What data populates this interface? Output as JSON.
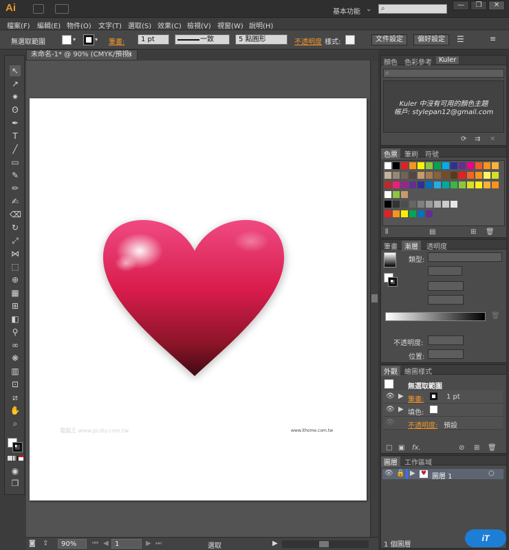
{
  "app": {
    "logo": "Ai",
    "workspace": "基本功能",
    "window_buttons": [
      "—",
      "❐",
      "✕"
    ]
  },
  "menubar": [
    "檔案(F)",
    "編輯(E)",
    "物件(O)",
    "文字(T)",
    "選取(S)",
    "效果(C)",
    "檢視(V)",
    "視窗(W)",
    "說明(H)"
  ],
  "control": {
    "no_selection": "無選取範圍",
    "stroke_label": "筆畫:",
    "stroke_value": "1 pt",
    "line_style": "一致",
    "brush": "5 點圓形",
    "opacity_label": "不透明度",
    "style_label": "樣式:",
    "doc_setup": "文件設定",
    "prefs": "偏好設定"
  },
  "document": {
    "tab_title": "未命名-1* @ 90% (CMYK/預視)",
    "close": "×",
    "watermark_left": "電腦王 www.pcdiy.com.tw",
    "watermark_right": "www.ithome.com.tw"
  },
  "status": {
    "zoom": "90%",
    "page": "1",
    "tool": "選取"
  },
  "panels": {
    "kuler": {
      "tabs": [
        "顏色",
        "色彩參考",
        "Kuler"
      ],
      "message": "Kuler 中沒有可用的顏色主題",
      "account": "帳戶: stylepan12@gmail.com"
    },
    "swatches": {
      "tabs": [
        "色票",
        "筆刷",
        "符號"
      ]
    },
    "gradient": {
      "tabs": [
        "筆畫",
        "漸層",
        "透明度"
      ],
      "type_label": "類型:",
      "opacity_label": "不透明度:",
      "position_label": "位置:"
    },
    "appearance": {
      "tabs": [
        "外觀",
        "繪圖樣式"
      ],
      "header": "無選取範圍",
      "stroke_label": "筆畫:",
      "stroke_value": "1 pt",
      "fill_label": "填色:",
      "opacity_label": "不透明度:",
      "opacity_value": "預設"
    },
    "layers": {
      "tabs": [
        "圖層",
        "工作區域"
      ],
      "layer_name": "圖層 1",
      "footer": "1 個圖層"
    }
  },
  "colors": {
    "accent": "#f0952a",
    "heart_top": "#e63a6f",
    "heart_bottom": "#5c0f1c"
  }
}
